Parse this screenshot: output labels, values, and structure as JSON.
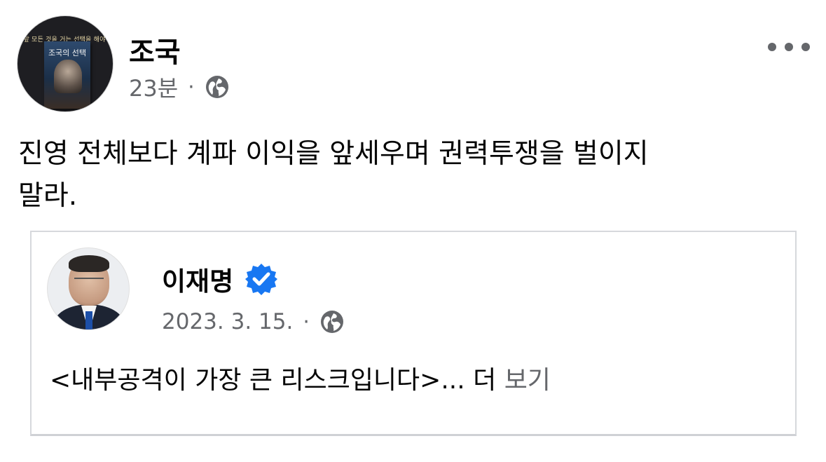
{
  "post": {
    "author": "조국",
    "timestamp": "23분",
    "separator": "·",
    "privacy_icon": "globe-icon",
    "more_icon": "more-horizontal-icon",
    "avatar": {
      "tagline": "눈앞 모든 것을 거는 선택을 해야 한다",
      "book_title": "조국의 선택"
    },
    "text_line1": "진영 전체보다 계파 이익을 앞세우며 권력투쟁을 벌이지",
    "text_line2": "말라."
  },
  "shared_post": {
    "author": "이재명",
    "verified_icon": "verified-badge-icon",
    "date": "2023. 3. 15.",
    "separator": "·",
    "privacy_icon": "globe-icon",
    "text": "<내부공격이 가장 큰 리스크입니다>... 더 ",
    "see_more": "보기"
  },
  "colors": {
    "text_primary": "#050505",
    "text_secondary": "#65676b",
    "verified_blue": "#1877f2",
    "card_border": "#d6d8dc"
  }
}
